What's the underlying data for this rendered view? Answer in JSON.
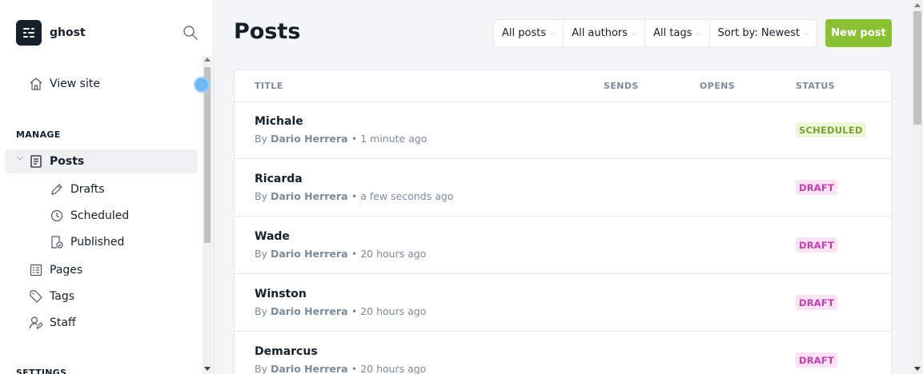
{
  "sidebar": {
    "brand": "ghost",
    "view_site": "View site",
    "manage_label": "MANAGE",
    "settings_label": "SETTINGS",
    "items": [
      {
        "label": "Posts"
      },
      {
        "label": "Drafts"
      },
      {
        "label": "Scheduled"
      },
      {
        "label": "Published"
      },
      {
        "label": "Pages"
      },
      {
        "label": "Tags"
      },
      {
        "label": "Staff"
      }
    ]
  },
  "header": {
    "title": "Posts",
    "filters": [
      "All posts",
      "All authors",
      "All tags",
      "Sort by: Newest"
    ],
    "new_post": "New post"
  },
  "table": {
    "columns": [
      "TITLE",
      "SENDS",
      "OPENS",
      "STATUS"
    ],
    "rows": [
      {
        "title": "Michale",
        "by": "By",
        "author": "Dario Herrera",
        "time": "• 1 minute ago",
        "status": "SCHEDULED"
      },
      {
        "title": "Ricarda",
        "by": "By",
        "author": "Dario Herrera",
        "time": "• a few seconds ago",
        "status": "DRAFT"
      },
      {
        "title": "Wade",
        "by": "By",
        "author": "Dario Herrera",
        "time": "• 20 hours ago",
        "status": "DRAFT"
      },
      {
        "title": "Winston",
        "by": "By",
        "author": "Dario Herrera",
        "time": "• 20 hours ago",
        "status": "DRAFT"
      },
      {
        "title": "Demarcus",
        "by": "By",
        "author": "Dario Herrera",
        "time": "• 20 hours ago",
        "status": "DRAFT"
      }
    ]
  },
  "colors": {
    "accent_green": "#8ac034",
    "scheduled_badge": "#7aa32a",
    "draft_badge": "#c43fb0"
  }
}
